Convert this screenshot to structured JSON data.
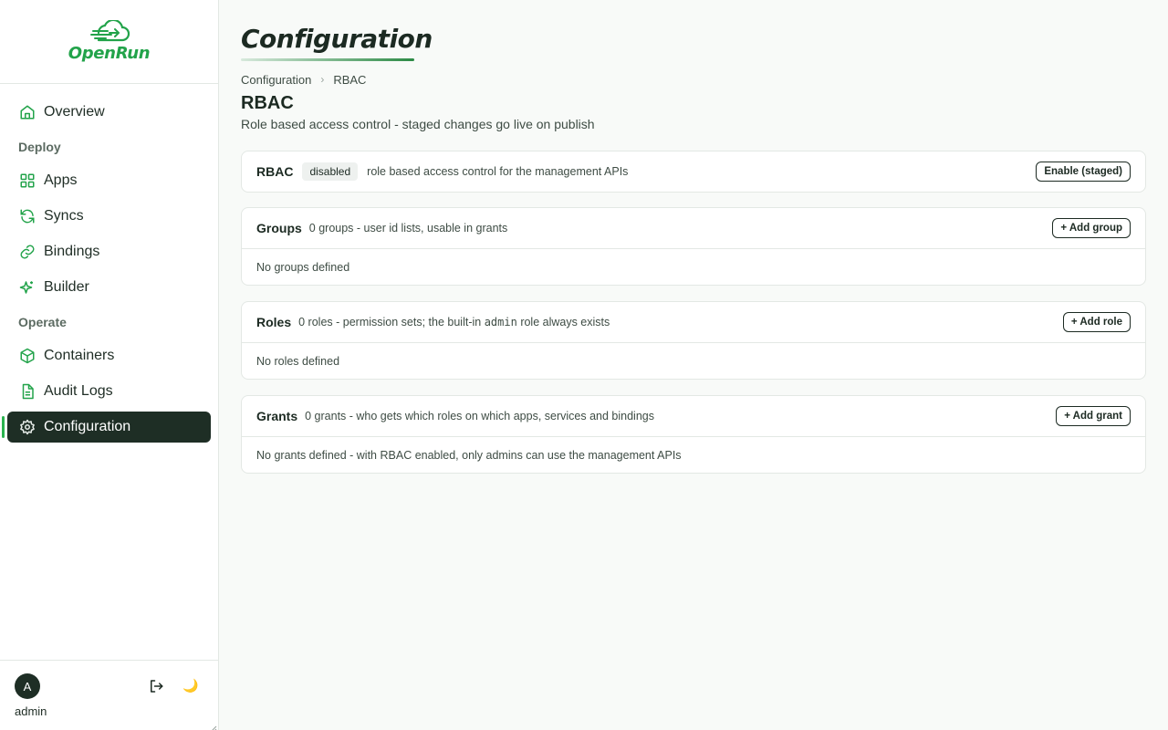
{
  "app": {
    "name": "OpenRun"
  },
  "sidebar": {
    "items": [
      {
        "label": "Overview"
      },
      {
        "section": "Deploy"
      },
      {
        "label": "Apps"
      },
      {
        "label": "Syncs"
      },
      {
        "label": "Bindings"
      },
      {
        "label": "Builder"
      },
      {
        "section": "Operate"
      },
      {
        "label": "Containers"
      },
      {
        "label": "Audit Logs"
      },
      {
        "label": "Configuration",
        "active": true
      }
    ],
    "user": {
      "initial": "A",
      "name": "admin"
    },
    "theme_icon": "🌙"
  },
  "page": {
    "title": "Configuration",
    "breadcrumb": [
      "Configuration",
      "RBAC"
    ],
    "breadcrumb_sep": "›",
    "section_title": "RBAC",
    "section_desc": "Role based access control - staged changes go live on publish"
  },
  "rbac": {
    "title": "RBAC",
    "status": "disabled",
    "desc": "role based access control for the management APIs",
    "button": "Enable (staged)"
  },
  "groups": {
    "title": "Groups",
    "desc": "0 groups - user id lists, usable in grants",
    "button": "+ Add group",
    "empty": "No groups defined"
  },
  "roles": {
    "title": "Roles",
    "desc_prefix": "0 roles - permission sets; the built-in",
    "desc_code": "admin",
    "desc_suffix": "role always exists",
    "button": "+ Add role",
    "empty": "No roles defined"
  },
  "grants": {
    "title": "Grants",
    "desc": "0 grants - who gets which roles on which apps, services and bindings",
    "button": "+ Add grant",
    "empty": "No grants defined - with RBAC enabled, only admins can use the management APIs"
  },
  "colors": {
    "brand": "#22a34a",
    "active_bg": "#1e2e25",
    "active_indicator": "#2bb34f"
  }
}
